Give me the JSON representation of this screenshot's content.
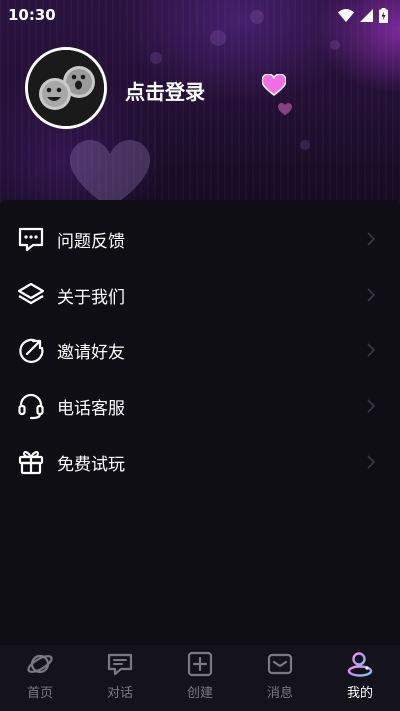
{
  "status_bar": {
    "time": "10:30"
  },
  "profile": {
    "login_label": "点击登录"
  },
  "menu": {
    "items": [
      {
        "label": "问题反馈",
        "icon": "feedback-chat-icon"
      },
      {
        "label": "关于我们",
        "icon": "layers-icon"
      },
      {
        "label": "邀请好友",
        "icon": "share-circle-arrow-icon"
      },
      {
        "label": "电话客服",
        "icon": "headset-icon"
      },
      {
        "label": "免费试玩",
        "icon": "gift-icon"
      }
    ]
  },
  "bottom_nav": {
    "items": [
      {
        "label": "首页",
        "icon": "planet-icon",
        "active": false
      },
      {
        "label": "对话",
        "icon": "chat-bubble-icon",
        "active": false
      },
      {
        "label": "创建",
        "icon": "plus-square-icon",
        "active": false
      },
      {
        "label": "消息",
        "icon": "mail-icon",
        "active": false
      },
      {
        "label": "我的",
        "icon": "profile-icon",
        "active": true
      }
    ]
  },
  "colors": {
    "background": "#0e0d14",
    "nav_background": "#14131b",
    "inactive_nav": "#7a7885",
    "accent_pink": "#e64fd8",
    "hero_purple": "#2a1240"
  }
}
